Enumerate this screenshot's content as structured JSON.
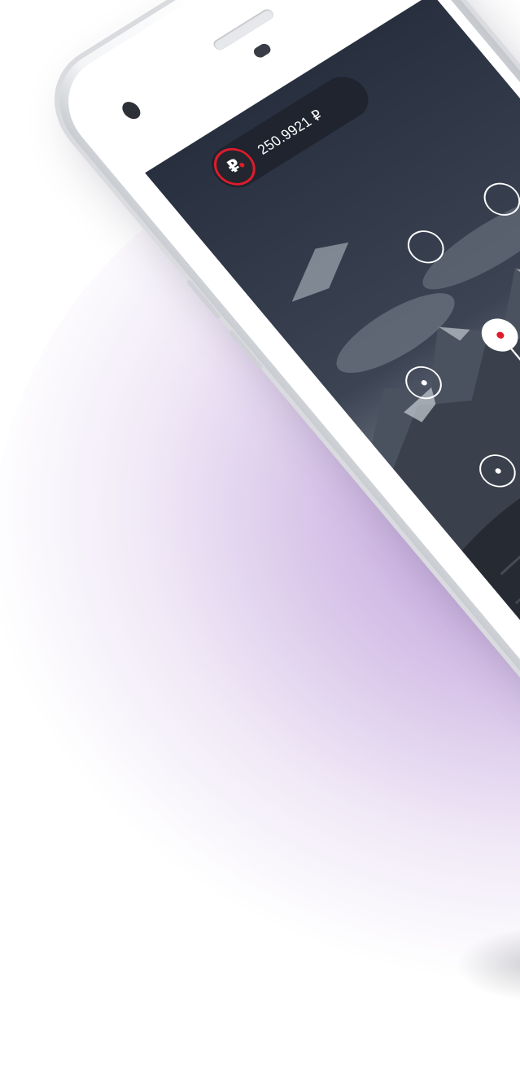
{
  "wallet": {
    "coin_symbol": "₽",
    "balance": "250.9921 ₽",
    "accent_color": "#e01b2b"
  },
  "pattern_lock": {
    "nodes": [
      {
        "id": "node-1",
        "style": "dot"
      },
      {
        "id": "node-2",
        "style": "ring"
      },
      {
        "id": "node-3",
        "style": "ring"
      },
      {
        "id": "node-4",
        "style": "dot"
      },
      {
        "id": "node-5",
        "style": "active"
      },
      {
        "id": "node-6",
        "style": "ring"
      },
      {
        "id": "node-7",
        "style": "dot"
      },
      {
        "id": "node-8",
        "style": "dot"
      },
      {
        "id": "node-9",
        "style": "dot"
      }
    ]
  },
  "colors": {
    "background_glow": "#b497d6",
    "phone_frame": "#e9eaee",
    "screen_dark": "#2c3342"
  }
}
